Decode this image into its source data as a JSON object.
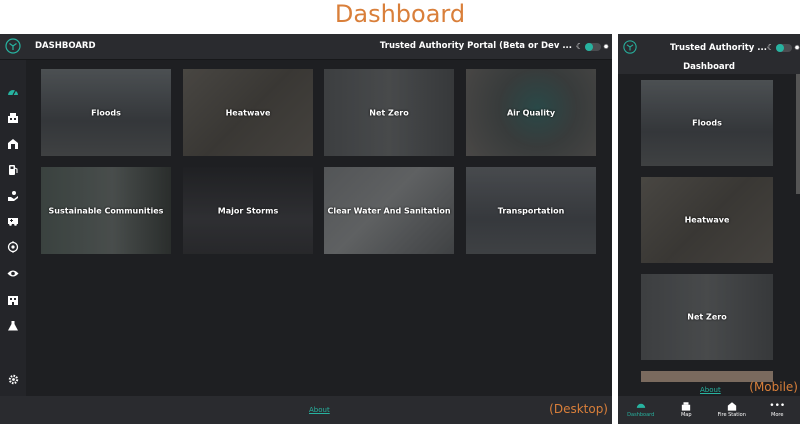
{
  "page": {
    "title": "Dashboard"
  },
  "desktop": {
    "header_title": "DASHBOARD",
    "portal_title": "Trusted Authority Portal (Beta or Dev ...",
    "sidebar": [
      {
        "icon": "dashboard-icon",
        "active": true
      },
      {
        "icon": "map-icon"
      },
      {
        "icon": "fire-station-icon"
      },
      {
        "icon": "fuel-icon"
      },
      {
        "icon": "hand-icon"
      },
      {
        "icon": "ambulance-icon"
      },
      {
        "icon": "target-icon"
      },
      {
        "icon": "eye-icon"
      },
      {
        "icon": "building-icon"
      },
      {
        "icon": "flask-icon"
      },
      {
        "icon": "gear-icon"
      },
      {
        "icon": "user-icon"
      }
    ],
    "tiles": [
      {
        "label": "Floods",
        "color": "#5a5f63"
      },
      {
        "label": "Heatwave",
        "color": "#63605b"
      },
      {
        "label": "Net Zero",
        "color": "#5d6062"
      },
      {
        "label": "Air Quality",
        "color": "#5e6262"
      },
      {
        "label": "Sustainable Communities",
        "color": "#56625e"
      },
      {
        "label": "Major Storms",
        "color": "#3c3d42"
      },
      {
        "label": "Clear Water And Sanitation",
        "color": "#6a6d70"
      },
      {
        "label": "Transportation",
        "color": "#5b5f64"
      }
    ],
    "about": "About",
    "caption": "(Desktop)"
  },
  "mobile": {
    "portal_title": "Trusted Authority ...",
    "dashboard_label": "Dashboard",
    "tiles": [
      {
        "label": "Floods"
      },
      {
        "label": "Heatwave"
      },
      {
        "label": "Net Zero"
      }
    ],
    "about": "About",
    "caption": "(Mobile)",
    "bottom_nav": [
      {
        "label": "Dashboard",
        "icon": "dashboard-icon",
        "active": true
      },
      {
        "label": "Map",
        "icon": "map-icon"
      },
      {
        "label": "Fire Station",
        "icon": "fire-station-icon"
      },
      {
        "label": "More",
        "icon": "more-icon"
      }
    ]
  },
  "colors": {
    "accent": "#27b3a0",
    "caption": "#d97f3a"
  }
}
